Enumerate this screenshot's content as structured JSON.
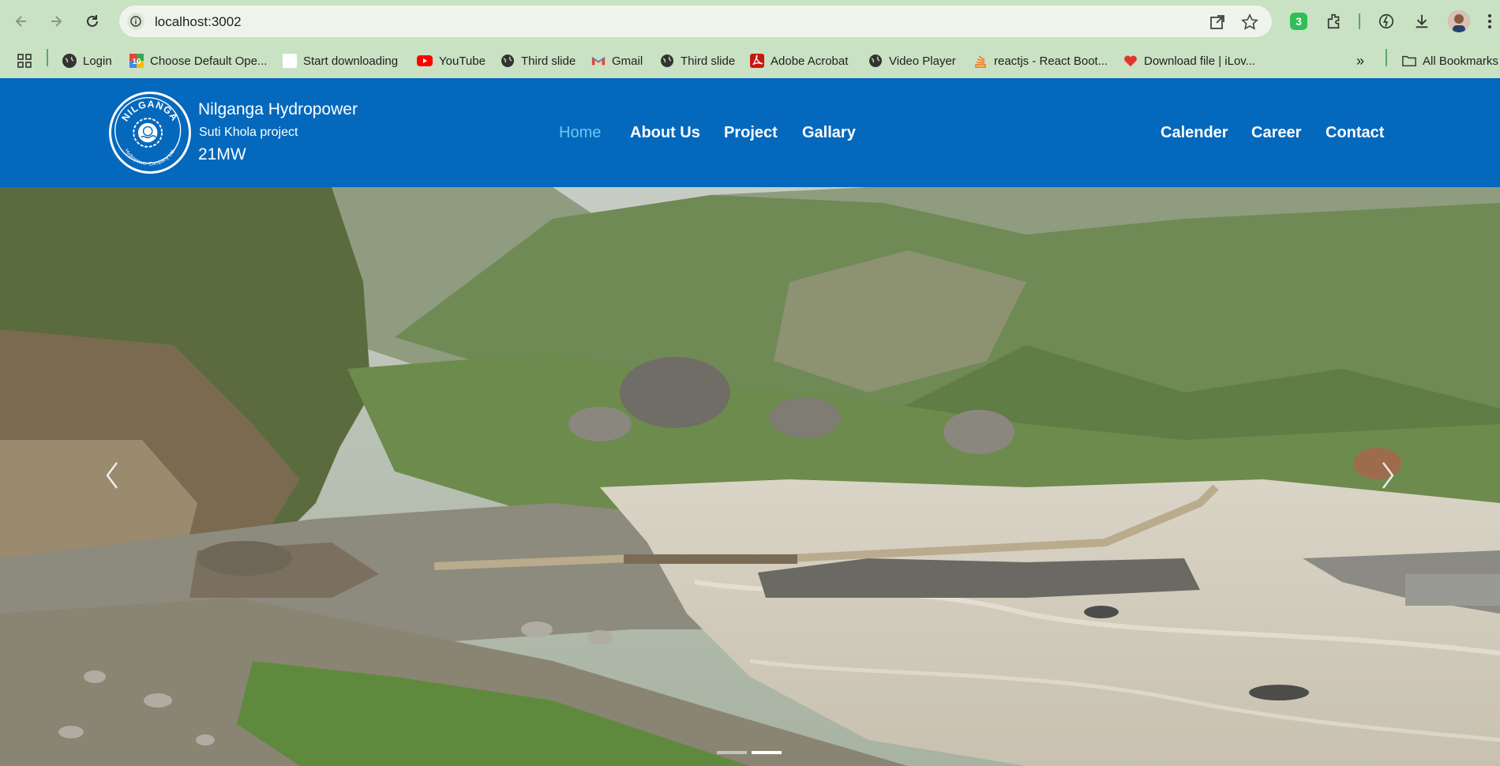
{
  "browser": {
    "url": "localhost:3002",
    "bookmarks": [
      {
        "label": "Login",
        "icon": "globe-icon"
      },
      {
        "label": "Choose Default Ope...",
        "icon": "app-icon"
      },
      {
        "label": "Start downloading",
        "icon": "blank-page-icon"
      },
      {
        "label": "YouTube",
        "icon": "youtube-icon"
      },
      {
        "label": "Third slide",
        "icon": "globe-icon"
      },
      {
        "label": "Gmail",
        "icon": "gmail-icon"
      },
      {
        "label": "Third slide",
        "icon": "globe-icon"
      },
      {
        "label": "Adobe Acrobat",
        "icon": "acrobat-icon"
      },
      {
        "label": "Video Player",
        "icon": "globe-icon"
      },
      {
        "label": "reactjs - React Boot...",
        "icon": "stack-icon"
      },
      {
        "label": "Download file | iLov...",
        "icon": "heart-icon"
      }
    ],
    "all_bookmarks": "All Bookmarks",
    "extension_badge": "3"
  },
  "site": {
    "brand": {
      "name": "Nilganga Hydropower",
      "subtitle": "Suti Khola project",
      "capacity": "21MW",
      "logo_top_text": "NILGANGA",
      "logo_bottom_text": "Hydropower Company Ltd."
    },
    "nav_left": [
      "Home",
      "About Us",
      "Project",
      "Gallary"
    ],
    "nav_right": [
      "Calender",
      "Career",
      "Contact"
    ],
    "active_nav": "Home"
  },
  "colors": {
    "header_bg": "#0468bd",
    "active_link": "#6cc8f4",
    "chrome_bg": "#c9e2c3"
  },
  "carousel": {
    "slide_count": 2,
    "active_index": 1
  }
}
